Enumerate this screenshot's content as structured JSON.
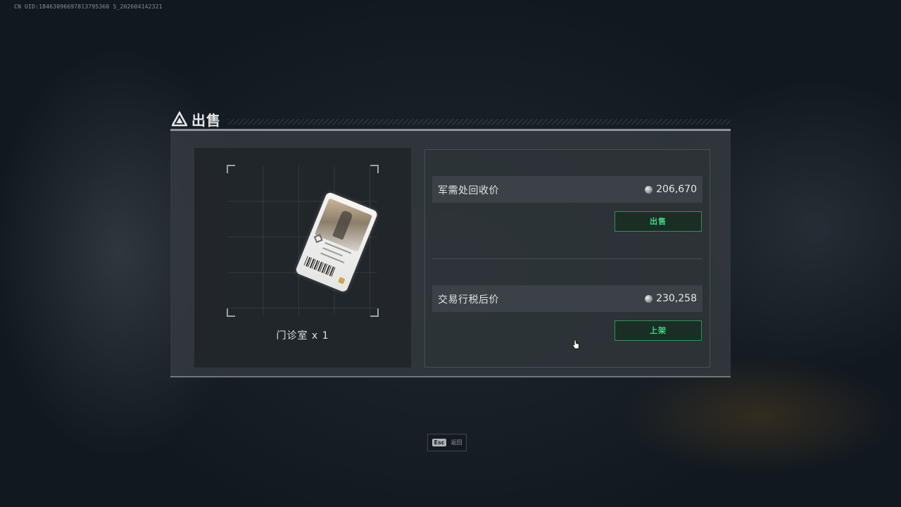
{
  "header": {
    "uid": "CN UID:18463096697813795360 5_202604142321"
  },
  "dialog": {
    "title": "出售",
    "title_icon": "triangle-warning-icon",
    "item": {
      "name": "门诊室 x 1",
      "image": "access-card-icon"
    },
    "recycle": {
      "label": "军需处回收价",
      "value": "206,670",
      "currency_icon": "coin-icon",
      "button": "出售"
    },
    "market": {
      "label": "交易行税后价",
      "value": "230,258",
      "currency_icon": "coin-icon",
      "button": "上架"
    }
  },
  "footer": {
    "esc_key": "Esc",
    "esc_label": "返回"
  },
  "colors": {
    "accent_green": "#42d77e",
    "button_border": "#2f8f56",
    "panel_bg": "#343a3f"
  }
}
